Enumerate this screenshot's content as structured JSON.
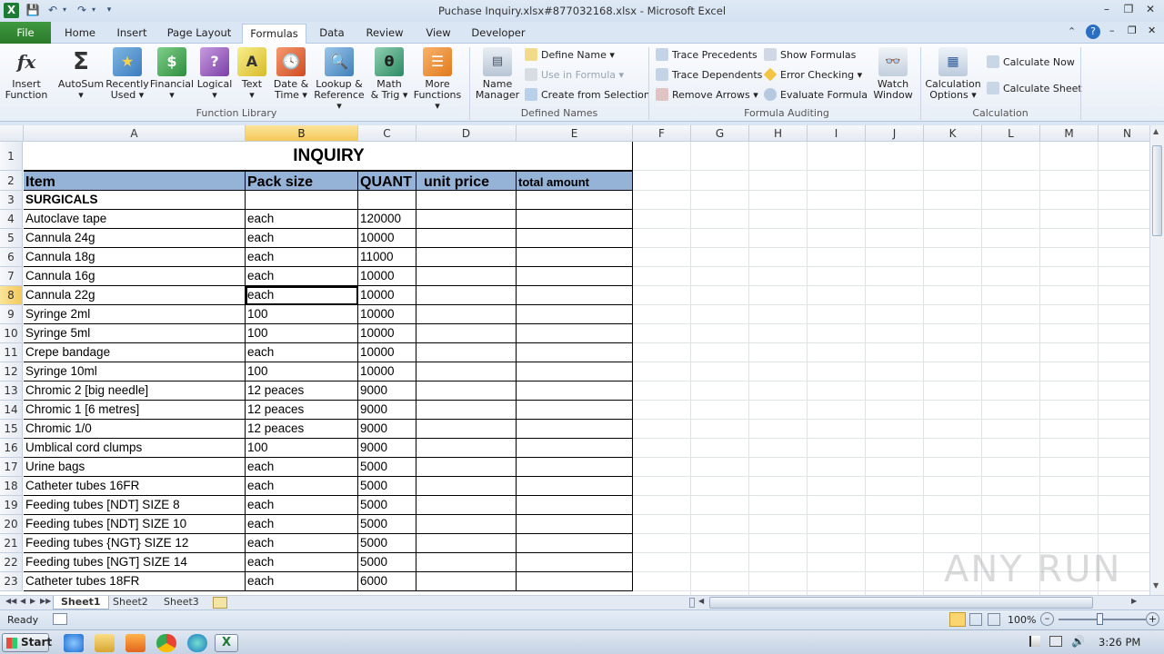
{
  "window": {
    "title": "Puchase Inquiry.xlsx#877032168.xlsx - Microsoft Excel",
    "app_icon": "excel-icon"
  },
  "tabs": [
    "File",
    "Home",
    "Insert",
    "Page Layout",
    "Formulas",
    "Data",
    "Review",
    "View",
    "Developer"
  ],
  "active_tab": "Formulas",
  "ribbon": {
    "function_library": {
      "label": "Function Library",
      "buttons": [
        {
          "l1": "Insert",
          "l2": "Function",
          "icon": "fx-icon"
        },
        {
          "l1": "AutoSum",
          "l2": "▾",
          "icon": "sigma-icon"
        },
        {
          "l1": "Recently",
          "l2": "Used ▾",
          "icon": "star-book-icon"
        },
        {
          "l1": "Financial",
          "l2": "▾",
          "icon": "financial-book-icon"
        },
        {
          "l1": "Logical",
          "l2": "▾",
          "icon": "logical-book-icon"
        },
        {
          "l1": "Text",
          "l2": "▾",
          "icon": "text-book-icon"
        },
        {
          "l1": "Date &",
          "l2": "Time ▾",
          "icon": "datetime-book-icon"
        },
        {
          "l1": "Lookup &",
          "l2": "Reference ▾",
          "icon": "lookup-book-icon"
        },
        {
          "l1": "Math",
          "l2": "& Trig ▾",
          "icon": "math-book-icon"
        },
        {
          "l1": "More",
          "l2": "Functions ▾",
          "icon": "more-books-icon"
        }
      ]
    },
    "defined_names": {
      "label": "Defined Names",
      "name_manager": {
        "l1": "Name",
        "l2": "Manager"
      },
      "define_name": "Define Name ▾",
      "use_in_formula": "Use in Formula ▾",
      "create_from_selection": "Create from Selection"
    },
    "formula_auditing": {
      "label": "Formula Auditing",
      "trace_precedents": "Trace Precedents",
      "trace_dependents": "Trace Dependents",
      "remove_arrows": "Remove Arrows ▾",
      "show_formulas": "Show Formulas",
      "error_checking": "Error Checking ▾",
      "evaluate_formula": "Evaluate Formula",
      "watch_window": {
        "l1": "Watch",
        "l2": "Window"
      }
    },
    "calculation": {
      "label": "Calculation",
      "options": {
        "l1": "Calculation",
        "l2": "Options ▾"
      },
      "calc_now": "Calculate Now",
      "calc_sheet": "Calculate Sheet"
    }
  },
  "columns": [
    "A",
    "B",
    "C",
    "D",
    "E",
    "F",
    "G",
    "H",
    "I",
    "J",
    "K",
    "L",
    "M",
    "N"
  ],
  "selected_column": "B",
  "selected_row": 8,
  "sheet": {
    "title": "INQUIRY",
    "headers": [
      "Item",
      "Pack size",
      "QUANT",
      "unit price",
      "total amount"
    ],
    "rows": [
      [
        "SURGICALS",
        "",
        "",
        "",
        ""
      ],
      [
        "Autoclave tape",
        "each",
        "120000",
        "",
        ""
      ],
      [
        "Cannula 24g",
        "each",
        "10000",
        "",
        ""
      ],
      [
        "Cannula 18g",
        "each",
        "11000",
        "",
        ""
      ],
      [
        "Cannula 16g",
        "each",
        "10000",
        "",
        ""
      ],
      [
        "Cannula 22g",
        "each",
        "10000",
        "",
        ""
      ],
      [
        "Syringe 2ml",
        "100",
        "10000",
        "",
        ""
      ],
      [
        "Syringe 5ml",
        "100",
        "10000",
        "",
        ""
      ],
      [
        "Crepe bandage",
        "each",
        "10000",
        "",
        ""
      ],
      [
        "Syringe 10ml",
        "100",
        "10000",
        "",
        ""
      ],
      [
        "Chromic 2 [big needle]",
        "12 peaces",
        "9000",
        "",
        ""
      ],
      [
        "Chromic 1 [6 metres]",
        "12 peaces",
        "9000",
        "",
        ""
      ],
      [
        "Chromic 1/0",
        "12 peaces",
        "9000",
        "",
        ""
      ],
      [
        "Umblical cord clumps",
        "100",
        "9000",
        "",
        ""
      ],
      [
        "Urine bags",
        "each",
        "5000",
        "",
        ""
      ],
      [
        "Catheter tubes 16FR",
        "each",
        "5000",
        "",
        ""
      ],
      [
        "Feeding tubes [NDT] SIZE     8",
        "each",
        "5000",
        "",
        ""
      ],
      [
        "Feeding tubes [NDT] SIZE     10",
        "each",
        "5000",
        "",
        ""
      ],
      [
        "Feeding tubes {NGT}  SIZE 12",
        "each",
        "5000",
        "",
        ""
      ],
      [
        "Feeding tubes [NGT] SIZE 14",
        "each",
        "5000",
        "",
        ""
      ],
      [
        "Catheter tubes 18FR",
        "each",
        "6000",
        "",
        ""
      ]
    ]
  },
  "sheet_tabs": [
    "Sheet1",
    "Sheet2",
    "Sheet3"
  ],
  "active_sheet": "Sheet1",
  "status": {
    "ready": "Ready",
    "zoom": "100%"
  },
  "taskbar": {
    "start": "Start",
    "time": "3:26 PM"
  },
  "watermark": "ANY RUN"
}
